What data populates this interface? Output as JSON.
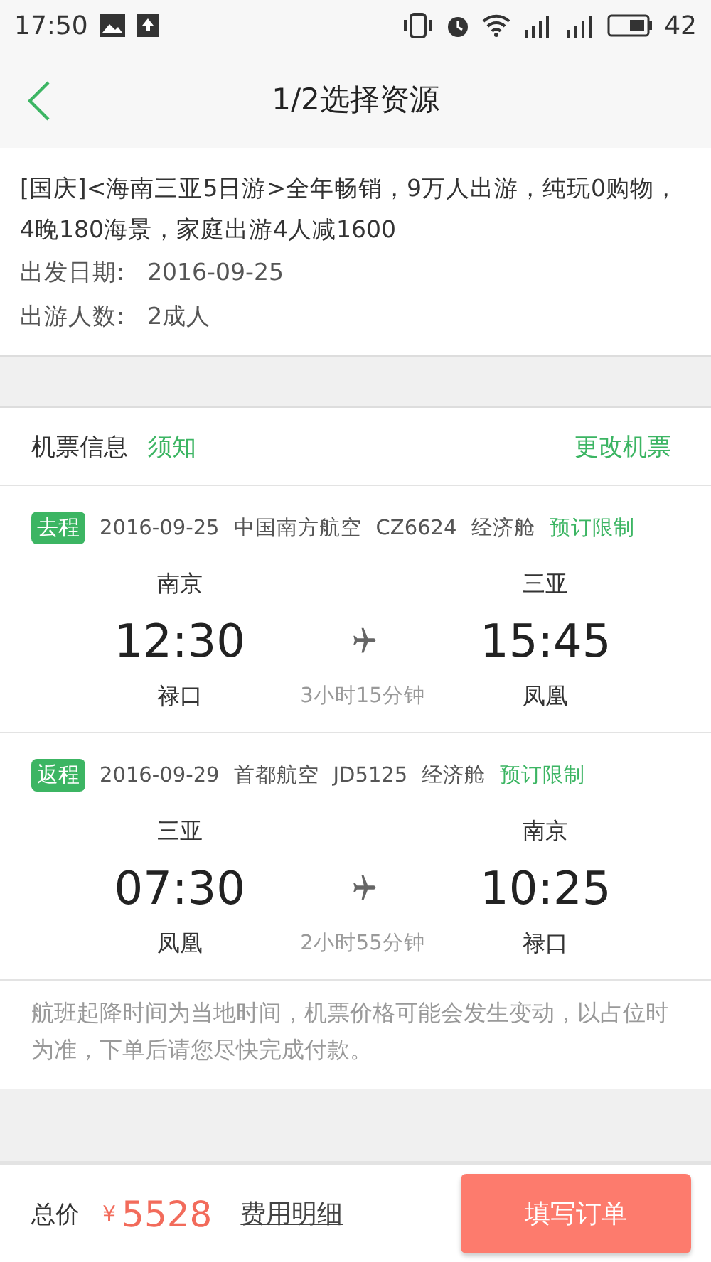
{
  "status_bar": {
    "time": "17:50",
    "battery": "42"
  },
  "nav": {
    "title": "1/2选择资源"
  },
  "product": {
    "title": "[国庆]<海南三亚5日游>全年畅销，9万人出游，纯玩0购物，4晚180海景，家庭出游4人减1600",
    "fields": [
      {
        "label": "出发日期:",
        "value": "2016-09-25"
      },
      {
        "label": "出游人数:",
        "value": "2成人"
      }
    ]
  },
  "ticket_header": {
    "title": "机票信息",
    "notice": "须知",
    "change": "更改机票"
  },
  "flights": [
    {
      "tag": "去程",
      "date": "2016-09-25",
      "airline": "中国南方航空",
      "number": "CZ6624",
      "cabin": "经济舱",
      "limit": "预订限制",
      "from_city": "南京",
      "to_city": "三亚",
      "depart": "12:30",
      "arrive": "15:45",
      "from_airport": "禄口",
      "to_airport": "凤凰",
      "duration": "3小时15分钟"
    },
    {
      "tag": "返程",
      "date": "2016-09-29",
      "airline": "首都航空",
      "number": "JD5125",
      "cabin": "经济舱",
      "limit": "预订限制",
      "from_city": "三亚",
      "to_city": "南京",
      "depart": "07:30",
      "arrive": "10:25",
      "from_airport": "凤凰",
      "to_airport": "禄口",
      "duration": "2小时55分钟"
    }
  ],
  "note": "航班起降时间为当地时间，机票价格可能会发生变动，以占位时为准，下单后请您尽快完成付款。",
  "footer": {
    "total_label": "总价",
    "currency": "¥",
    "price": "5528",
    "detail_link": "费用明细",
    "submit": "填写订单"
  }
}
